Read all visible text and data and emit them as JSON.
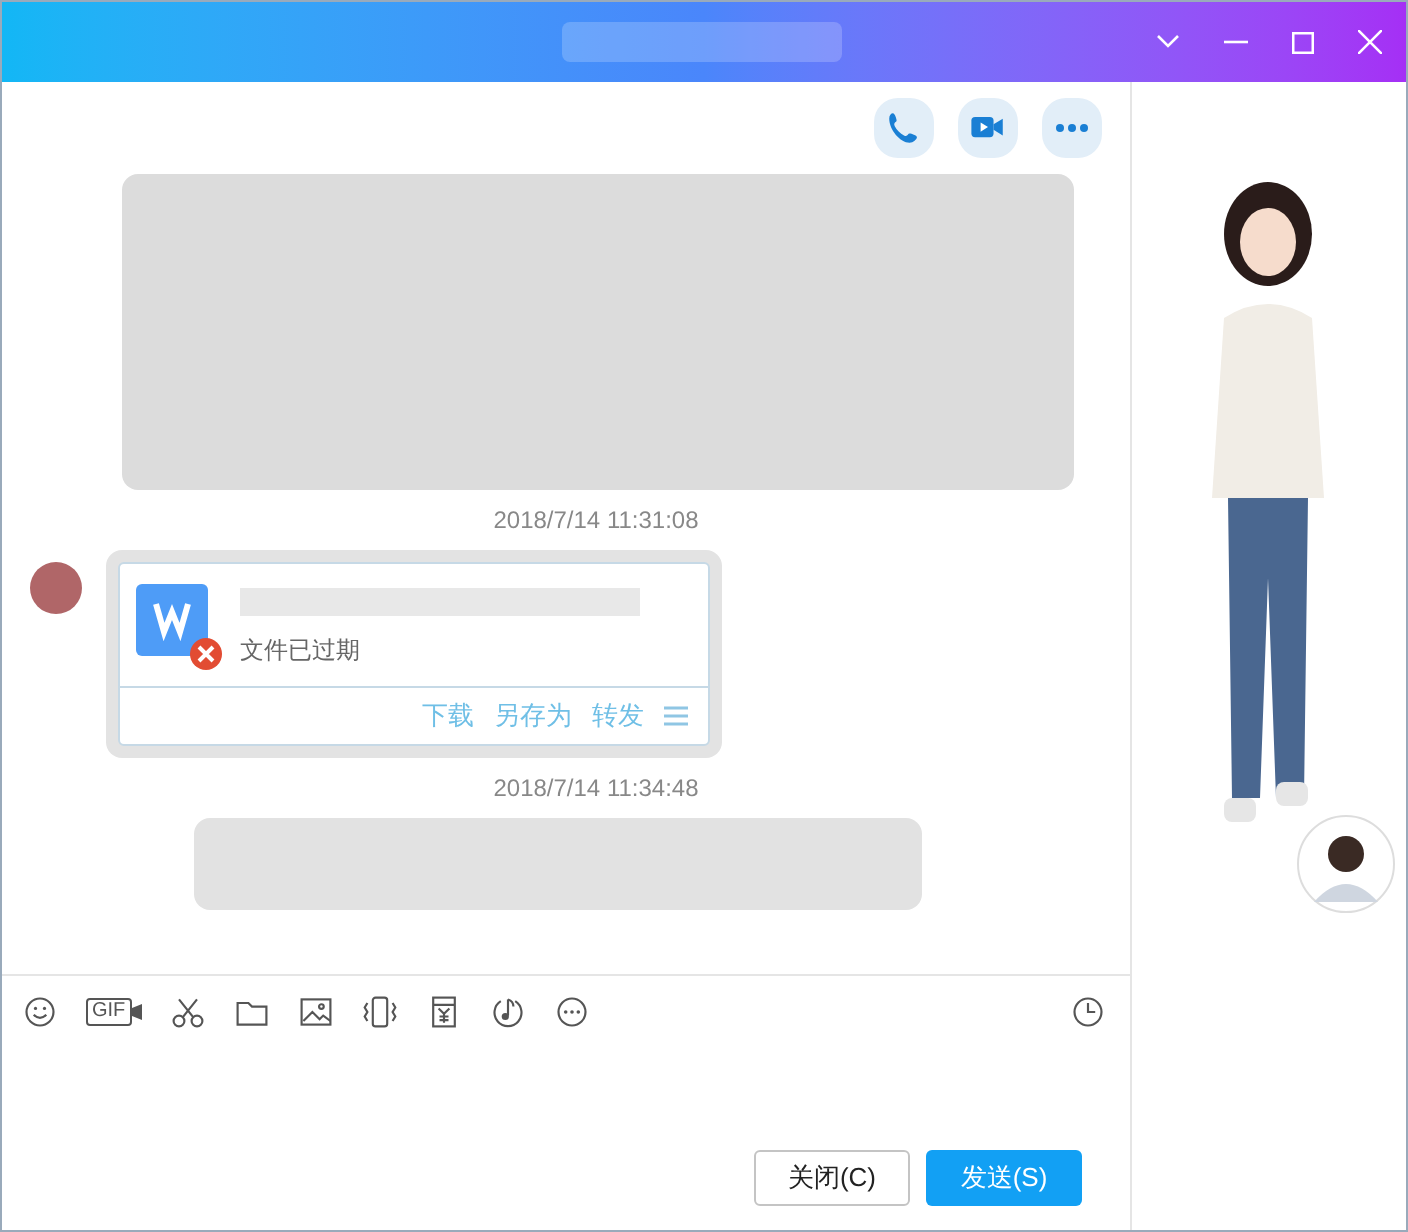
{
  "header_actions": [
    {
      "kind": "phone"
    },
    {
      "kind": "video"
    },
    {
      "kind": "more"
    }
  ],
  "messages": [
    {
      "kind": "blurred_long"
    },
    {
      "kind": "time",
      "text": "2018/7/14 11:31:08"
    },
    {
      "kind": "file",
      "status": "文件已过期",
      "actions": [
        "下载",
        "另存为",
        "转发"
      ]
    },
    {
      "kind": "time",
      "text": "2018/7/14 11:34:48"
    },
    {
      "kind": "blurred_short"
    }
  ],
  "toolbar": [
    {
      "kind": "emoji"
    },
    {
      "kind": "gif",
      "label": "GIF"
    },
    {
      "kind": "scissors"
    },
    {
      "kind": "folder"
    },
    {
      "kind": "image"
    },
    {
      "kind": "shake"
    },
    {
      "kind": "money"
    },
    {
      "kind": "music"
    },
    {
      "kind": "more"
    }
  ],
  "buttons": [
    {
      "label": "关闭(C)",
      "primary": false
    },
    {
      "label": "发送(S)",
      "primary": true
    }
  ]
}
